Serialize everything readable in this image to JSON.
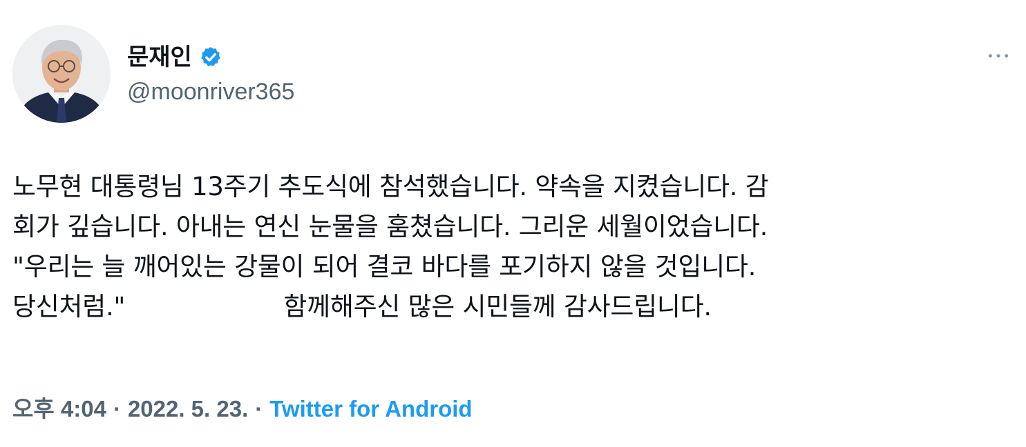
{
  "user": {
    "display_name": "문재인",
    "handle": "@moonriver365",
    "verified": true
  },
  "tweet": {
    "text": "노무현 대통령님 13주기 추도식에 참석했습니다. 약속을 지켰습니다. 감\n회가 깊습니다. 아내는 연신 눈물을 훔쳤습니다. 그리운 세월이었습니다.\n\"우리는 늘 깨어있는 강물이 되어 결코 바다를 포기하지 않을 것입니다.\n당신처럼.\"                    함께해주신 많은 시민들께 감사드립니다."
  },
  "meta": {
    "time": "오후 4:04",
    "separator": "·",
    "date": "2022. 5. 23.",
    "source": "Twitter for Android"
  },
  "colors": {
    "text": "#0f1419",
    "secondary": "#536471",
    "accent": "#1d9bf0"
  },
  "icons": {
    "verified": "verified-badge-icon",
    "more": "more-horizontal-icon"
  }
}
